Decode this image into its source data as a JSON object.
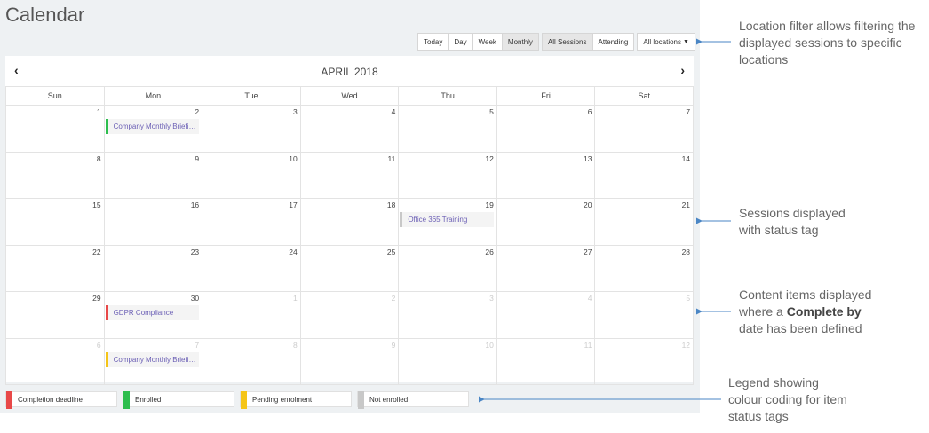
{
  "page": {
    "title": "Calendar"
  },
  "toolbar": {
    "today": "Today",
    "day": "Day",
    "week": "Week",
    "monthly": "Monthly",
    "all_sessions": "All Sessions",
    "attending": "Attending",
    "locations": "All locations"
  },
  "calendar": {
    "month_title": "APRIL 2018",
    "prev_icon": "chevron-left-icon",
    "next_icon": "chevron-right-icon",
    "weekdays": [
      "Sun",
      "Mon",
      "Tue",
      "Wed",
      "Thu",
      "Fri",
      "Sat"
    ],
    "weeks": [
      [
        "1",
        "2",
        "3",
        "4",
        "5",
        "6",
        "7"
      ],
      [
        "8",
        "9",
        "10",
        "11",
        "12",
        "13",
        "14"
      ],
      [
        "15",
        "16",
        "17",
        "18",
        "19",
        "20",
        "21"
      ],
      [
        "22",
        "23",
        "24",
        "25",
        "26",
        "27",
        "28"
      ],
      [
        "29",
        "30",
        "1",
        "2",
        "3",
        "4",
        "5"
      ],
      [
        "6",
        "7",
        "8",
        "9",
        "10",
        "11",
        "12"
      ]
    ],
    "events": [
      {
        "week": 0,
        "day": 1,
        "label": "Company Monthly Briefi…",
        "color": "#2dbe4e"
      },
      {
        "week": 2,
        "day": 4,
        "label": "Office 365 Training",
        "color": "#c8c8c8"
      },
      {
        "week": 4,
        "day": 1,
        "label": "GDPR Compliance",
        "color": "#e84848"
      },
      {
        "week": 5,
        "day": 1,
        "label": "Company Monthly Briefi…",
        "color": "#f5c518"
      }
    ]
  },
  "legend": [
    {
      "label": "Completion deadline",
      "color": "#e84848"
    },
    {
      "label": "Enrolled",
      "color": "#2dbe4e"
    },
    {
      "label": "Pending enrolment",
      "color": "#f5c518"
    },
    {
      "label": "Not enrolled",
      "color": "#c8c8c8"
    }
  ],
  "annotations": {
    "location_filter": "Location filter allows filtering the displayed sessions to specific locations",
    "sessions_1": "Sessions displayed",
    "sessions_2": "with status tag",
    "content_1": "Content items displayed",
    "content_2": "where a",
    "content_bold": "Complete by",
    "content_3": "date has been defined",
    "legend_1": "Legend showing",
    "legend_2": "colour coding for item",
    "legend_3": "status tags"
  },
  "colors": {
    "arrow": "#4a86c5"
  }
}
